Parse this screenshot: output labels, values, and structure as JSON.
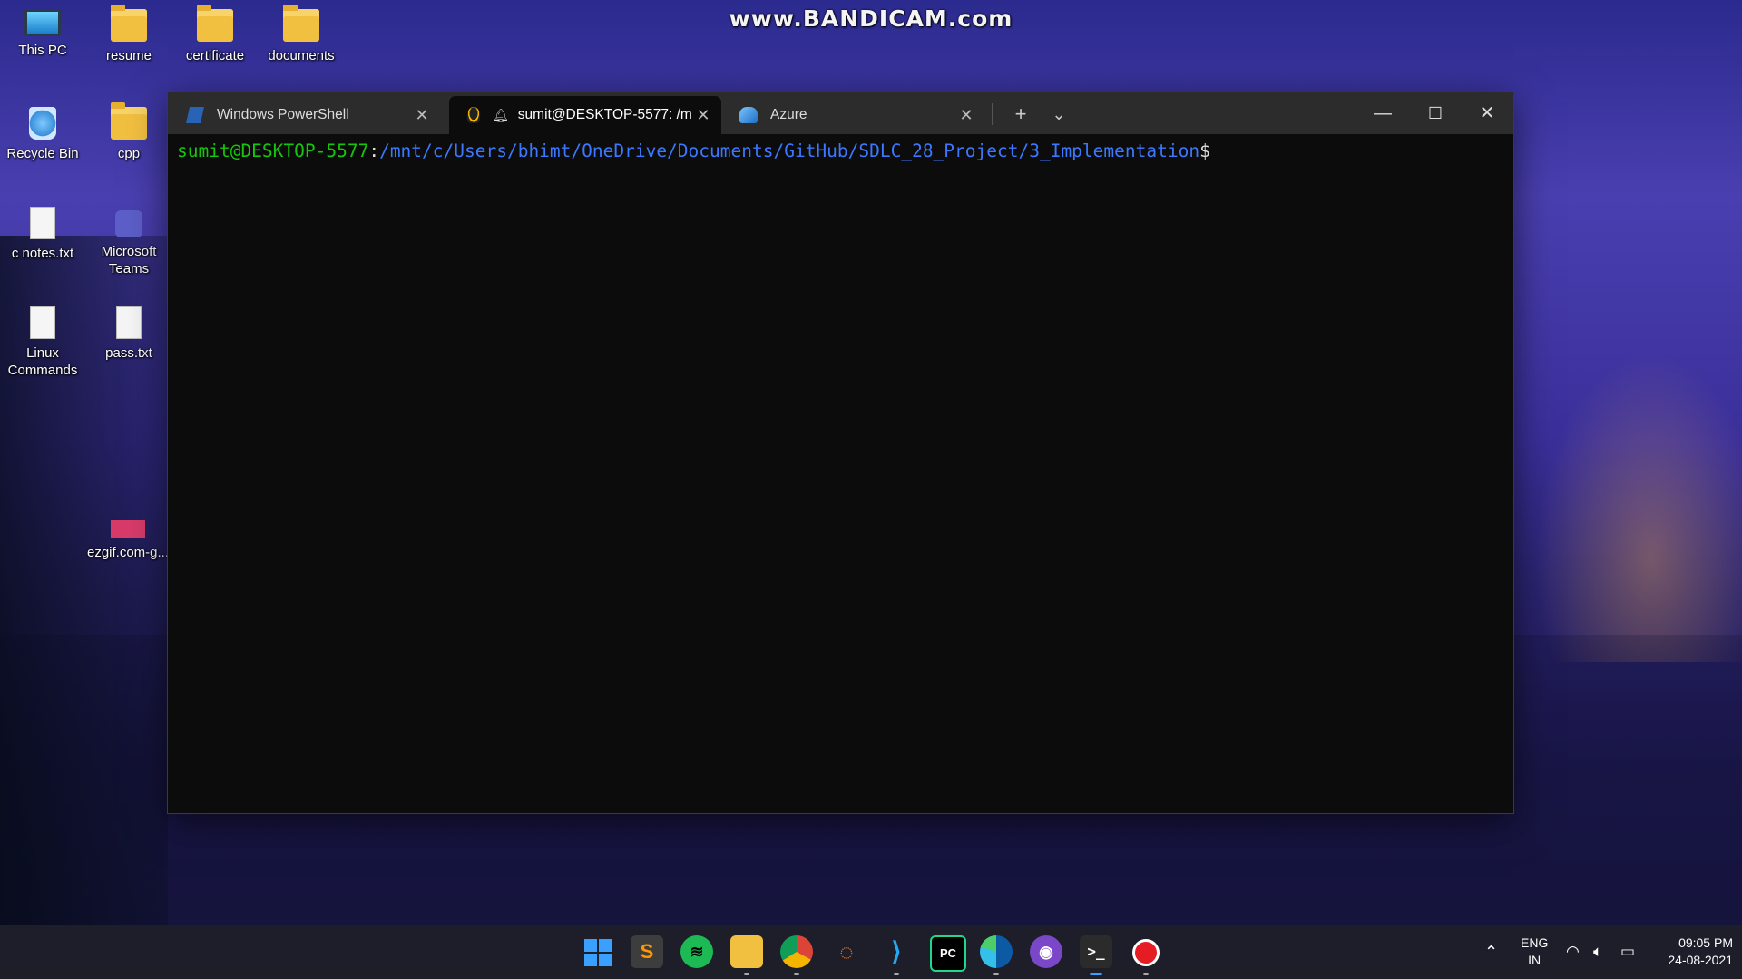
{
  "watermark": "www.BANDICAM.com",
  "desktop": {
    "icons": [
      {
        "label": "This PC",
        "icon": "this-pc-icon"
      },
      {
        "label": "resume",
        "icon": "folder-icon"
      },
      {
        "label": "certificate",
        "icon": "folder-icon"
      },
      {
        "label": "documents",
        "icon": "folder-icon"
      },
      {
        "label": "Recycle Bin",
        "icon": "recycle-bin-icon"
      },
      {
        "label": "cpp",
        "icon": "folder-icon"
      },
      {
        "label": "c notes.txt",
        "icon": "text-file-icon"
      },
      {
        "label": "Microsoft Teams",
        "icon": "teams-icon"
      },
      {
        "label": "Linux Commands",
        "icon": "text-file-icon"
      },
      {
        "label": "pass.txt",
        "icon": "text-file-icon"
      },
      {
        "label": "ezgif.com-g...",
        "icon": "gif-file-icon"
      }
    ]
  },
  "terminal": {
    "tabs": [
      {
        "title": "Windows PowerShell",
        "icon": "powershell-icon",
        "active": false
      },
      {
        "title": "sumit@DESKTOP-5577: /m",
        "icon": "linux-tux-icon",
        "active": true
      },
      {
        "title": "Azure",
        "icon": "azure-cloud-icon",
        "active": false
      }
    ],
    "new_tab": "+",
    "dropdown": "⌄",
    "prompt": {
      "user_host": "sumit@DESKTOP-5577",
      "separator": ":",
      "path": "/mnt/c/Users/bhimt/OneDrive/Documents/GitHub/SDLC_28_Project/3_Implementation",
      "symbol": "$"
    }
  },
  "taskbar": {
    "apps": [
      "start-icon",
      "sublime-text-icon",
      "spotify-icon",
      "file-explorer-icon",
      "chrome-icon",
      "jupyter-icon",
      "vscode-icon",
      "pycharm-icon",
      "edge-icon",
      "github-desktop-icon",
      "terminal-icon",
      "bandicam-record-icon"
    ],
    "language": "ENG",
    "region": "IN",
    "time": "09:05 PM",
    "date": "24-08-2021"
  },
  "colors": {
    "prompt_user": "#16c60c",
    "prompt_path": "#3b78ff",
    "terminal_bg": "#0c0c0c"
  }
}
